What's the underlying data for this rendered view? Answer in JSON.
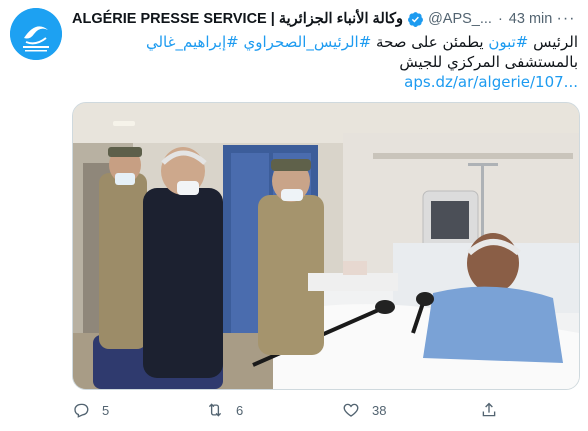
{
  "tweet": {
    "author_name": "ALGÉRIE PRESSE SERVICE | وكالة الأنباء الجزائرية",
    "handle": "@APS_...",
    "separator": "·",
    "time": "43 min",
    "more_label": "···",
    "text": {
      "line1": [
        "الرئيس ",
        "#تبون",
        " يطمئن على صحة ",
        "#الرئيس_الصحراوي",
        " ",
        "#إبراهيم_غالي"
      ],
      "line1_hashtag_flags": [
        false,
        true,
        false,
        true,
        false,
        true
      ],
      "line2": "بالمستشفى المركزي للجيش",
      "link": "aps.dz/ar/algerie/107..."
    },
    "image_alt": "photo",
    "actions": {
      "reply_count": "5",
      "retweet_count": "6",
      "like_count": "38"
    }
  },
  "icons": {
    "avatar": "aps-logo-icon",
    "verified": "verified-badge-icon",
    "reply": "reply-icon",
    "retweet": "retweet-icon",
    "like": "heart-icon",
    "share": "share-icon"
  },
  "colors": {
    "accent": "#1d9bf0",
    "text": "#0f1419",
    "muted": "#536471",
    "avatar_bg": "#1da1f2"
  }
}
